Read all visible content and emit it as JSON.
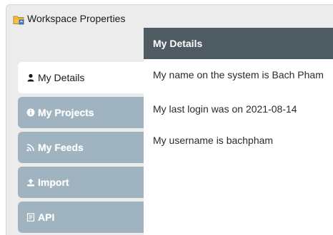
{
  "window": {
    "title": "Workspace Properties",
    "title_icon": "folder-icon"
  },
  "tabs": [
    {
      "label": "My Details",
      "icon": "user-icon",
      "active": true
    },
    {
      "label": "My Projects",
      "icon": "info-circle-icon",
      "active": false
    },
    {
      "label": "My Feeds",
      "icon": "rss-icon",
      "active": false
    },
    {
      "label": "Import",
      "icon": "upload-icon",
      "active": false
    },
    {
      "label": "API",
      "icon": "document-icon",
      "active": false
    }
  ],
  "panel": {
    "header": "My Details",
    "lines": [
      "My name on the system is Bach Pham",
      "My last login was on 2021-08-14",
      "My username is bachpham"
    ]
  },
  "colors": {
    "header_bg": "#4f5b62",
    "tab_inactive_bg": "#9fb4c0",
    "window_bg": "#ececec"
  }
}
